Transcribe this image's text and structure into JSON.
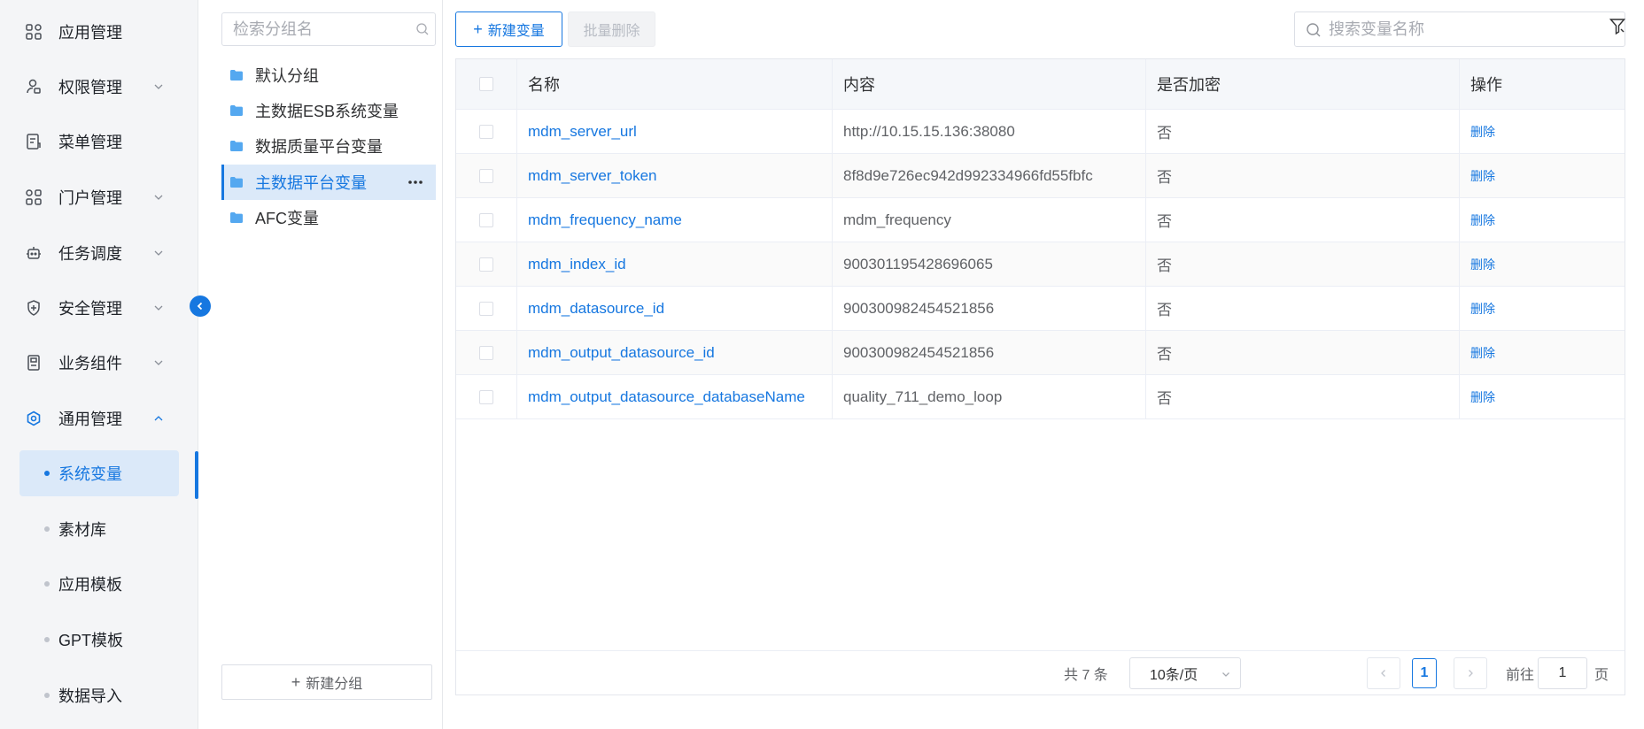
{
  "sidebar": {
    "items": [
      {
        "label": "应用管理",
        "icon": "apps-grid-icon"
      },
      {
        "label": "权限管理",
        "icon": "user-lock-icon"
      },
      {
        "label": "菜单管理",
        "icon": "menu-doc-icon"
      },
      {
        "label": "门户管理",
        "icon": "portal-grid-icon"
      },
      {
        "label": "任务调度",
        "icon": "robot-icon"
      },
      {
        "label": "安全管理",
        "icon": "shield-icon"
      },
      {
        "label": "业务组件",
        "icon": "component-icon"
      },
      {
        "label": "通用管理",
        "icon": "general-settings-icon"
      }
    ],
    "sub_items": [
      {
        "label": "系统变量",
        "active": true
      },
      {
        "label": "素材库"
      },
      {
        "label": "应用模板"
      },
      {
        "label": "GPT模板"
      },
      {
        "label": "数据导入"
      }
    ]
  },
  "groups": {
    "search_placeholder": "检索分组名",
    "items": [
      {
        "label": "默认分组"
      },
      {
        "label": "主数据ESB系统变量"
      },
      {
        "label": "数据质量平台变量"
      },
      {
        "label": "主数据平台变量",
        "active": true
      },
      {
        "label": "AFC变量"
      }
    ],
    "add_label": "新建分组"
  },
  "toolbar": {
    "new_label": "新建变量",
    "batch_delete_label": "批量删除",
    "search_placeholder": "搜索变量名称"
  },
  "table": {
    "columns": {
      "name": "名称",
      "content": "内容",
      "encrypted": "是否加密",
      "action": "操作"
    },
    "rows": [
      {
        "name": "mdm_server_url",
        "content": "http://10.15.15.136:38080",
        "encrypted": "否",
        "action": "删除"
      },
      {
        "name": "mdm_server_token",
        "content": "8f8d9e726ec942d992334966fd55fbfc",
        "encrypted": "否",
        "action": "删除"
      },
      {
        "name": "mdm_frequency_name",
        "content": "mdm_frequency",
        "encrypted": "否",
        "action": "删除"
      },
      {
        "name": "mdm_index_id",
        "content": "900301195428696065",
        "encrypted": "否",
        "action": "删除"
      },
      {
        "name": "mdm_datasource_id",
        "content": "900300982454521856",
        "encrypted": "否",
        "action": "删除"
      },
      {
        "name": "mdm_output_datasource_id",
        "content": "900300982454521856",
        "encrypted": "否",
        "action": "删除"
      },
      {
        "name": "mdm_output_datasource_databaseName",
        "content": "quality_711_demo_loop",
        "encrypted": "否",
        "action": "删除"
      }
    ]
  },
  "pagination": {
    "total": "共 7 条",
    "page_size": "10条/页",
    "current_page": "1",
    "goto_prefix": "前往",
    "goto_value": "1",
    "goto_suffix": "页"
  },
  "colors": {
    "accent": "#1677e0",
    "sidebar_bg": "#f4f5f7",
    "active_bg": "#dbe9f9"
  }
}
